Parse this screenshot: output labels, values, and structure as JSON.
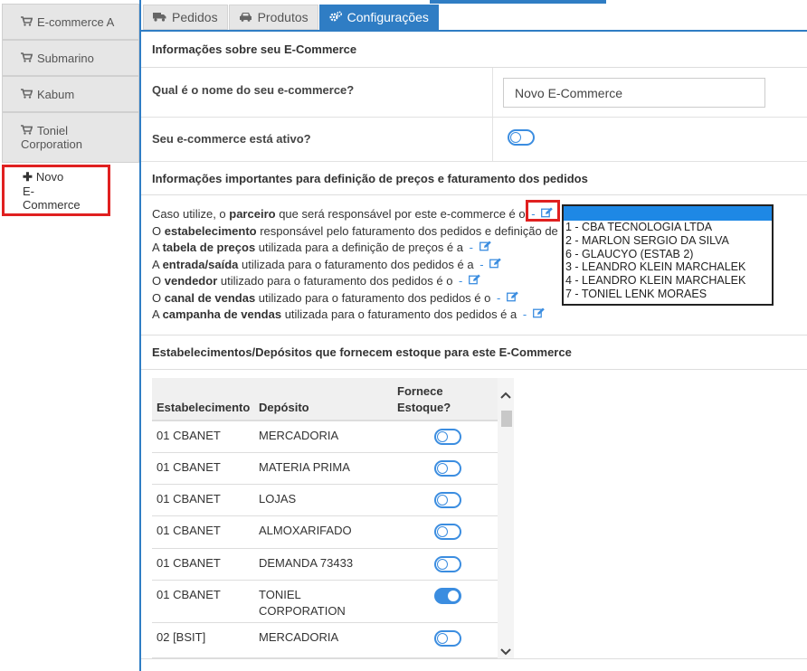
{
  "sidebar": {
    "items": [
      {
        "label": "E-commerce A"
      },
      {
        "label": "Submarino"
      },
      {
        "label": "Kabum"
      },
      {
        "label_line1": "Toniel",
        "label_line2": "Corporation"
      },
      {
        "label_line1": "Novo",
        "label_line2": "E-Commerce"
      }
    ]
  },
  "tabs": [
    {
      "label": "Pedidos"
    },
    {
      "label": "Produtos"
    },
    {
      "label": "Configurações"
    }
  ],
  "sections": {
    "info": "Informações sobre seu E-Commerce",
    "pricing": "Informações importantes para definição de preços e faturamento dos pedidos",
    "stock": "Estabelecimentos/Depósitos que fornecem estoque para este E-Commerce"
  },
  "form": {
    "name_label": "Qual é o nome do seu e-commerce?",
    "name_value": "Novo E-Commerce",
    "active_label": "Seu e-commerce está ativo?"
  },
  "info_lines": [
    {
      "pre": "Caso utilize, o ",
      "bold": "parceiro",
      "post": " que será responsável por este e-commerce é o",
      "dash": " -"
    },
    {
      "pre": "O ",
      "bold": "estabelecimento",
      "post": " responsável pelo faturamento dos pedidos e definição de",
      "dash": ""
    },
    {
      "pre": "A ",
      "bold": "tabela de preços",
      "post": " utilizada para a definição de preços é a",
      "dash": " -"
    },
    {
      "pre": "A ",
      "bold": "entrada/saída",
      "post": " utilizada para o faturamento dos pedidos é a",
      "dash": " -"
    },
    {
      "pre": "O ",
      "bold": "vendedor",
      "post": " utilizado para o faturamento dos pedidos é o",
      "dash": " -"
    },
    {
      "pre": "O ",
      "bold": "canal de vendas",
      "post": " utilizado para o faturamento dos pedidos é o",
      "dash": " -"
    },
    {
      "pre": "A ",
      "bold": "campanha de vendas",
      "post": " utilizada para o faturamento dos pedidos é a",
      "dash": " -"
    }
  ],
  "dropdown": {
    "options": [
      "1 - CBA TECNOLOGIA LTDA",
      "2 - MARLON SERGIO DA SILVA",
      "6 - GLAUCYO (ESTAB 2)",
      "3 - LEANDRO KLEIN MARCHALEK",
      "4 - LEANDRO KLEIN MARCHALEK",
      "7 - TONIEL LENK MORAES"
    ]
  },
  "table": {
    "headers": {
      "estab": "Estabelecimento",
      "deposito": "Depósito",
      "fornece1": "Fornece",
      "fornece2": "Estoque?"
    },
    "rows": [
      {
        "estab": "01 CBANET",
        "dep1": "MERCADORIA",
        "dep2": "",
        "on": false
      },
      {
        "estab": "01 CBANET",
        "dep1": "MATERIA PRIMA",
        "dep2": "",
        "on": false
      },
      {
        "estab": "01 CBANET",
        "dep1": "LOJAS",
        "dep2": "",
        "on": false
      },
      {
        "estab": "01 CBANET",
        "dep1": "ALMOXARIFADO",
        "dep2": "",
        "on": false
      },
      {
        "estab": "01 CBANET",
        "dep1": "DEMANDA 73433",
        "dep2": "",
        "on": false
      },
      {
        "estab": "01 CBANET",
        "dep1": "TONIEL",
        "dep2": "CORPORATION",
        "on": true
      },
      {
        "estab": "02 [BSIT]",
        "dep1": "MERCADORIA",
        "dep2": "",
        "on": false
      }
    ]
  },
  "colors": {
    "accent": "#2f7dc4",
    "toggle": "#3b8de0",
    "highlight": "#e02020",
    "selection": "#1e88e5"
  }
}
